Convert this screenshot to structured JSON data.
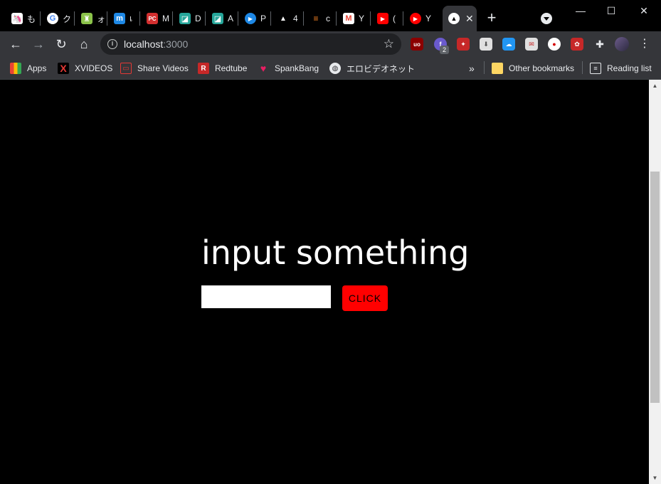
{
  "tabs": [
    {
      "icon": "unicorn-icon",
      "title": "も",
      "color": "#c62828"
    },
    {
      "icon": "google-icon",
      "title": "ク",
      "color": "#ffffff"
    },
    {
      "icon": "castle-icon",
      "title": "ォ",
      "color": "#8bc34a"
    },
    {
      "icon": "m-icon",
      "title": "เ",
      "color": "#1e88e5"
    },
    {
      "icon": "pcgamer-icon",
      "title": "M",
      "color": "#d32f2f"
    },
    {
      "icon": "d-icon",
      "title": "D",
      "color": "#26a69a"
    },
    {
      "icon": "a-icon",
      "title": "A",
      "color": "#26a69a"
    },
    {
      "icon": "play-icon",
      "title": "P",
      "color": "#1e88e5"
    },
    {
      "icon": "triangle-icon",
      "title": "4",
      "color": "#000000"
    },
    {
      "icon": "stackoverflow-icon",
      "title": "c",
      "color": "#f48024"
    },
    {
      "icon": "gmail-icon",
      "title": "Y",
      "color": "#ea4335"
    },
    {
      "icon": "youtube-icon",
      "title": "(",
      "color": "#ff0000"
    },
    {
      "icon": "youtube-music-icon",
      "title": "Y",
      "color": "#ff0000"
    }
  ],
  "active_tab": {
    "icon": "triangle-icon",
    "close": "✕"
  },
  "window_controls": {
    "minimize": "—",
    "maximize": "☐",
    "close": "✕"
  },
  "address": {
    "host": "localhost",
    "port": ":3000"
  },
  "bookmarks": [
    {
      "icon": "apps-icon",
      "label": "Apps"
    },
    {
      "icon": "xvideos-icon",
      "label": "XVIDEOS"
    },
    {
      "icon": "share-videos-icon",
      "label": "Share Videos"
    },
    {
      "icon": "redtube-icon",
      "label": "Redtube"
    },
    {
      "icon": "spankbang-icon",
      "label": "SpankBang"
    },
    {
      "icon": "globe-icon",
      "label": "エロビデオネット"
    }
  ],
  "bookmarks_overflow": "»",
  "other_bookmarks": "Other bookmarks",
  "reading_list": "Reading list",
  "extension_badge": "2",
  "page": {
    "heading": "input something",
    "input_value": "",
    "button_label": "CLICK"
  }
}
